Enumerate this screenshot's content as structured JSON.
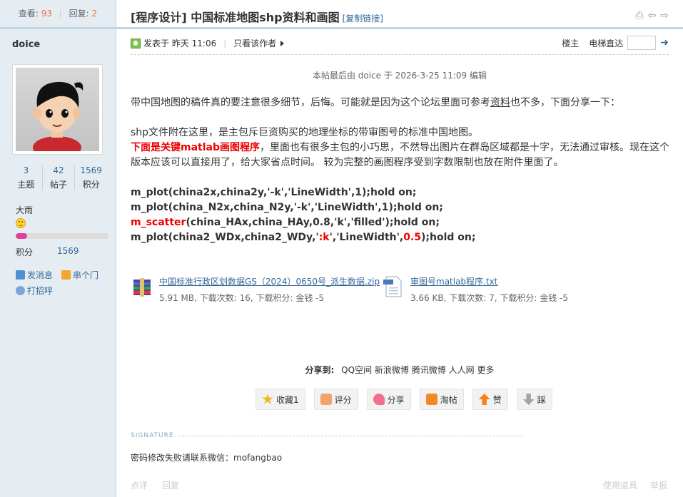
{
  "sidebar": {
    "views_label": "查看:",
    "views": "93",
    "replies_label": "回复:",
    "replies": "2",
    "author": "doice",
    "stats": [
      {
        "value": "3",
        "label": "主题"
      },
      {
        "value": "42",
        "label": "帖子"
      },
      {
        "value": "1569",
        "label": "积分"
      }
    ],
    "group": "大雨",
    "level_progress": 0.12,
    "points_label": "积分",
    "points": "1569",
    "links": [
      "发消息",
      "串个门",
      "打招呼"
    ]
  },
  "thread": {
    "title": "[程序设计] 中国标准地图shp资料和画图",
    "copy_link": "[复制链接]"
  },
  "post": {
    "posted": "发表于 昨天 11:06",
    "author_only": "只看该作者",
    "floor": "楼主",
    "elevator": "电梯直达",
    "edited": "本帖最后由 doice 于 2026-3-25 11:09 编辑",
    "p1_a": "带中国地图的稿件真的要注意很多细节，后悔。可能就是因为这个论坛里面可参考",
    "p1_link": "资料",
    "p1_b": "也不多，下面分享一下：",
    "p2": "shp文件附在这里，是主包斥巨资购买的地理坐标的带审图号的标准中国地图。",
    "p3_red": "下面是关键matlab画图程序",
    "p3": "，里面也有很多主包的小巧思，不然导出图片在群岛区域都是十字，无法通过审核。现在这个版本应该可以直接用了，给大家省点时间。 较为完整的画图程序受到字数限制也放在附件里面了。",
    "code1": "m_plot(china2x,china2y,'-k','LineWidth',1);hold on;",
    "code2": "m_plot(china_N2x,china_N2y,'-k','LineWidth',1);hold on;",
    "code3_red": "m_scatter",
    "code3": "(china_HAx,china_HAy,0.8,'k','filled');hold on;",
    "code4_a": "m_plot(china2_WDx,china2_WDy,'",
    "code4_red1": ":k",
    "code4_b": "','LineWidth',",
    "code4_red2": "0.5",
    "code4_c": ");hold on;",
    "attachments": [
      {
        "name": "中国标准行政区划数据GS（2024）0650号_派生数据.zip",
        "meta": "5.91 MB, 下载次数: 16, 下载积分: 金钱 -5"
      },
      {
        "name": "审图号matlab程序.txt",
        "meta": "3.66 KB, 下载次数: 7, 下载积分: 金钱 -5"
      }
    ],
    "share_label": "分享到:",
    "share_targets": [
      "QQ空间",
      "新浪微博",
      "腾讯微博",
      "人人网",
      "更多"
    ],
    "buttons": [
      "收藏1",
      "评分",
      "分享",
      "淘帖",
      "赞",
      "踩"
    ],
    "signature_label": "SIGNATURE",
    "signature": "密码修改失败请联系微信：mofangbao",
    "footer_left": [
      "点评",
      "回复"
    ],
    "footer_right": [
      "使用道具",
      "举报"
    ]
  }
}
